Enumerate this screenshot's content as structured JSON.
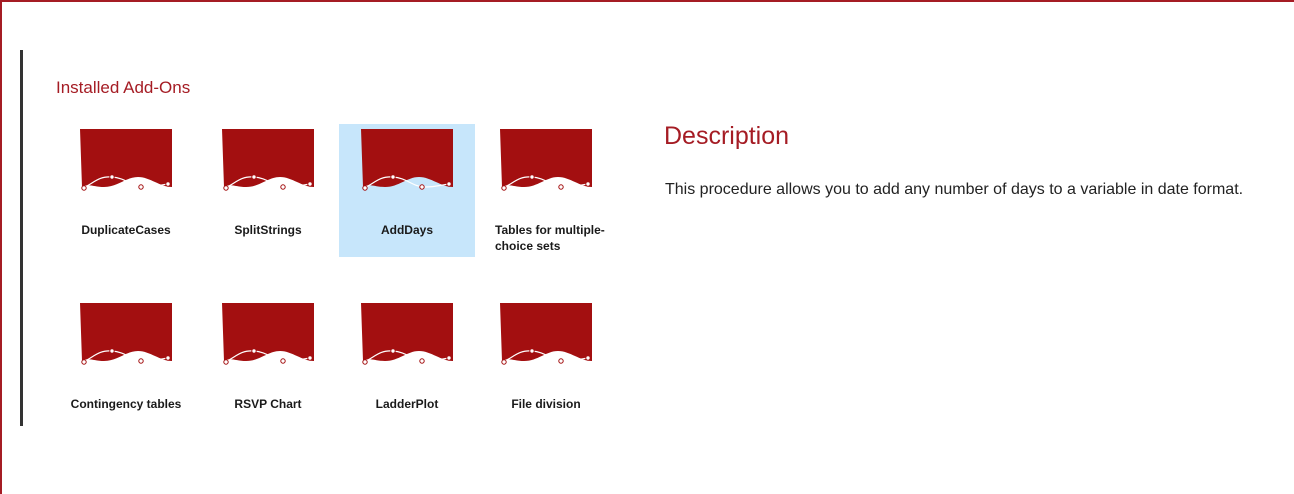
{
  "section": {
    "title": "Installed Add-Ons"
  },
  "addons": [
    {
      "label": "DuplicateCases",
      "selected": false
    },
    {
      "label": "SplitStrings",
      "selected": false
    },
    {
      "label": "AddDays",
      "selected": true
    },
    {
      "label": "Tables for multiple-choice sets",
      "selected": false
    },
    {
      "label": "Contingency tables",
      "selected": false
    },
    {
      "label": "RSVP Chart",
      "selected": false
    },
    {
      "label": "LadderPlot",
      "selected": false
    },
    {
      "label": "File division",
      "selected": false
    }
  ],
  "description": {
    "title": "Description",
    "text": "This procedure allows you to add any number of days to a variable in date format."
  },
  "colors": {
    "accent": "#a51c24",
    "icon_red": "#a30f10",
    "selection": "#c7e6fb",
    "rule": "#333333"
  },
  "icons": {
    "addon_icon": "addon-banner-icon"
  }
}
